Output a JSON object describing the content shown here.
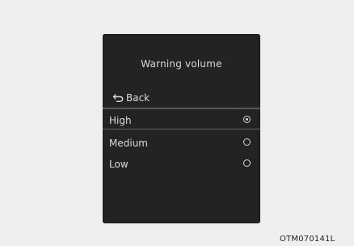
{
  "screen": {
    "title": "Warning volume",
    "back_label": "Back",
    "items": [
      {
        "label": "High",
        "selected": true
      },
      {
        "label": "Medium",
        "selected": false
      },
      {
        "label": "Low",
        "selected": false
      }
    ]
  },
  "caption": "OTM070141L"
}
